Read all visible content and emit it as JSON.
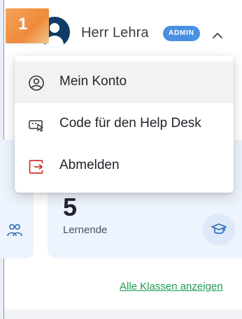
{
  "onboarding": {
    "step_number": "1"
  },
  "header": {
    "user_name": "Herr Lehra",
    "role_badge": "ADMIN"
  },
  "user_menu": {
    "items": [
      {
        "label": "Mein Konto",
        "icon": "account-circle-icon"
      },
      {
        "label": "Code für den Help Desk",
        "icon": "helpdesk-code-icon"
      },
      {
        "label": "Abmelden",
        "icon": "logout-icon",
        "color": "#d32f2f"
      }
    ]
  },
  "stats": {
    "number": "5",
    "label": "Lernende"
  },
  "links": {
    "all_classes": "Alle Klassen anzeigen"
  },
  "colors": {
    "brand_dark": "#0e3c66",
    "admin_badge": "#4a90e2",
    "link_green": "#1e9b4e",
    "logout_red": "#d32f2f",
    "step_badge": "#f08a3a"
  }
}
